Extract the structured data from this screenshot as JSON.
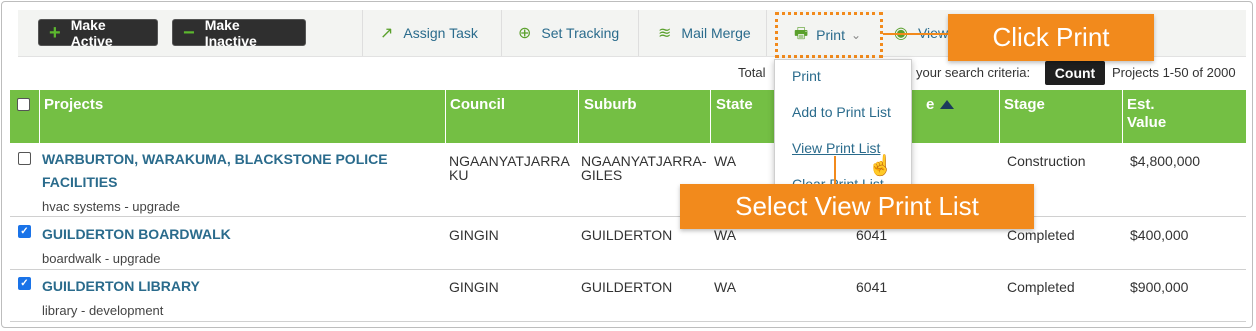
{
  "toolbar": {
    "make_active": "Make Active",
    "make_inactive": "Make Inactive",
    "assign_task": "Assign Task",
    "set_tracking": "Set Tracking",
    "mail_merge": "Mail Merge",
    "print": "Print",
    "view": "View",
    "icons": {
      "make_active": "plus-icon",
      "make_inactive": "minus-icon",
      "assign_task": "arrow-up-right-icon",
      "set_tracking": "crosshair-icon",
      "mail_merge": "layers-icon",
      "print": "printer-icon",
      "view": "eye-icon"
    }
  },
  "totals": {
    "prefix": "Total",
    "suffix": "your search criteria:",
    "count_button": "Count",
    "range": "Projects 1-50 of 2000"
  },
  "print_menu": {
    "items": [
      "Print",
      "Add to Print List",
      "View Print List",
      "Clear Print List"
    ]
  },
  "callouts": {
    "click_print": "Click Print",
    "select_view": "Select View Print List"
  },
  "table": {
    "headers": {
      "projects": "Projects",
      "council": "Council",
      "suburb": "Suburb",
      "state": "State",
      "postcode_partial": "e",
      "stage": "Stage",
      "value_line1": "Est.",
      "value_line2": "Value"
    },
    "rows": [
      {
        "checked": false,
        "name_line1": "WARBURTON, WARAKUMA, BLACKSTONE POLICE",
        "name_line2": "FACILITIES",
        "sub": "hvac systems - upgrade",
        "council_line1": "NGAANYATJARRA",
        "council_line2": "KU",
        "suburb_line1": "NGAANYATJARRA-",
        "suburb_line2": "GILES",
        "state": "WA",
        "postcode": "",
        "stage": "Construction",
        "value": "$4,800,000"
      },
      {
        "checked": true,
        "name_line1": "GUILDERTON BOARDWALK",
        "sub": "boardwalk - upgrade",
        "council_line1": "GINGIN",
        "suburb_line1": "GUILDERTON",
        "state": "WA",
        "postcode": "6041",
        "stage": "Completed",
        "value": "$400,000"
      },
      {
        "checked": true,
        "name_line1": "GUILDERTON LIBRARY",
        "sub": "library - development",
        "council_line1": "GINGIN",
        "suburb_line1": "GUILDERTON",
        "state": "WA",
        "postcode": "6041",
        "stage": "Completed",
        "value": "$900,000"
      }
    ]
  },
  "colors": {
    "header_green": "#74bf44",
    "callout_orange": "#f28a1c",
    "link_blue": "#2a6b8c",
    "button_dark": "#2f2f2f"
  }
}
